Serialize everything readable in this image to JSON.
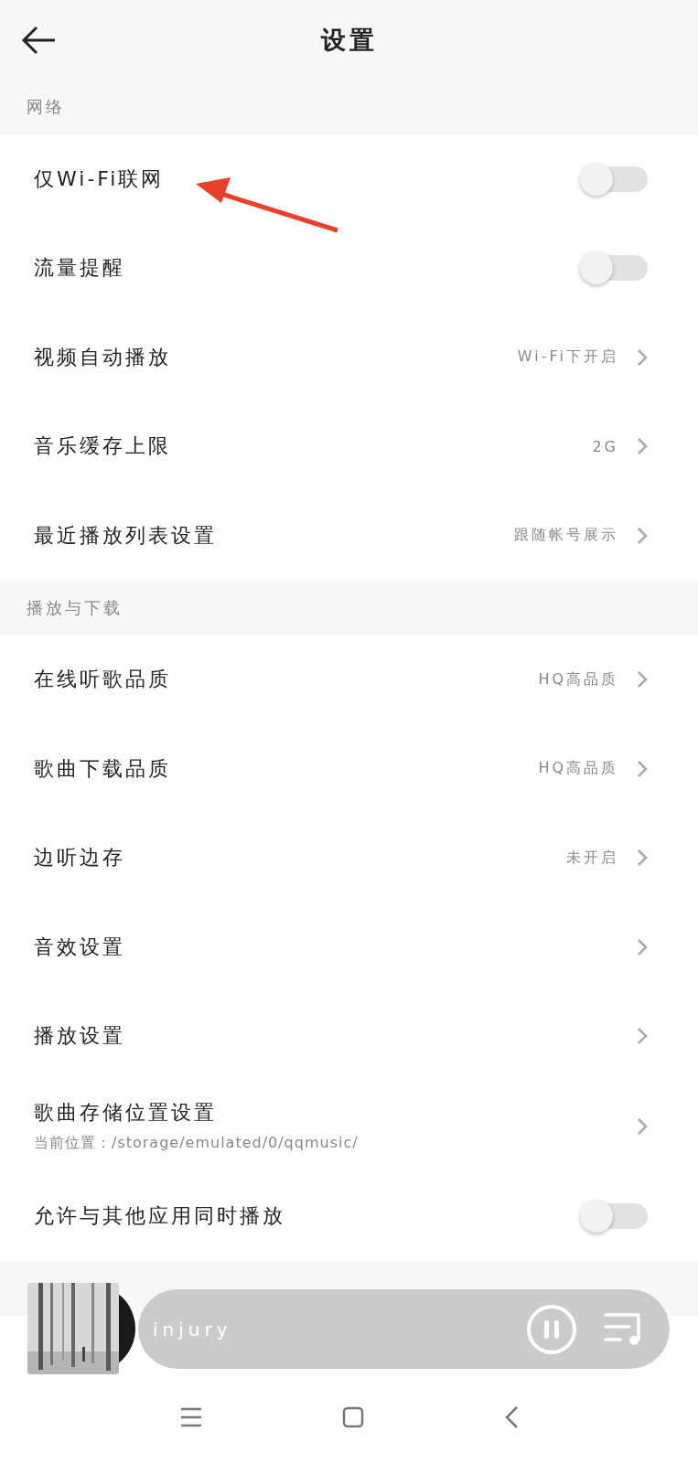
{
  "header": {
    "title": "设置"
  },
  "sections": [
    {
      "title": "网络",
      "rows": [
        {
          "kind": "toggle",
          "label": "仅Wi-Fi联网",
          "on": false
        },
        {
          "kind": "toggle",
          "label": "流量提醒",
          "on": false
        },
        {
          "kind": "link",
          "label": "视频自动播放",
          "value": "Wi-Fi下开启"
        },
        {
          "kind": "link",
          "label": "音乐缓存上限",
          "value": "2G"
        },
        {
          "kind": "link",
          "label": "最近播放列表设置",
          "value": "跟随帐号展示"
        }
      ]
    },
    {
      "title": "播放与下载",
      "rows": [
        {
          "kind": "link",
          "label": "在线听歌品质",
          "value": "HQ高品质"
        },
        {
          "kind": "link",
          "label": "歌曲下载品质",
          "value": "HQ高品质"
        },
        {
          "kind": "link",
          "label": "边听边存",
          "value": "未开启"
        },
        {
          "kind": "link",
          "label": "音效设置"
        },
        {
          "kind": "link",
          "label": "播放设置"
        },
        {
          "kind": "link",
          "label": "歌曲存储位置设置",
          "subtitle": "当前位置：/storage/emulated/0/qqmusic/"
        },
        {
          "kind": "toggle",
          "label": "允许与其他应用同时播放",
          "on": false
        }
      ]
    }
  ],
  "player": {
    "song": "injury",
    "playing": true
  }
}
